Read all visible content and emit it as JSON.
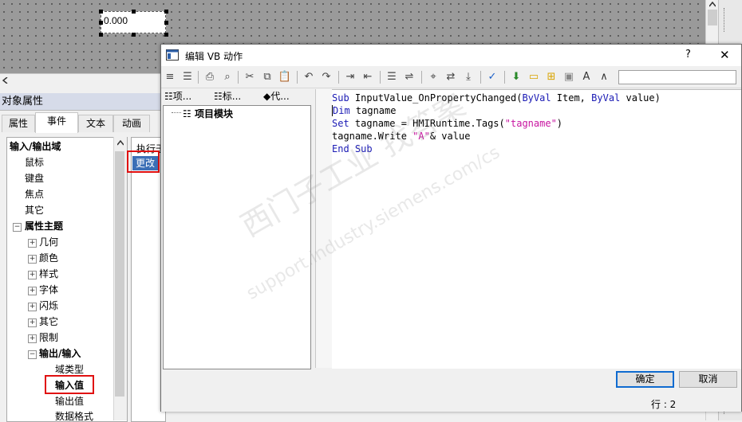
{
  "canvas": {
    "io_field_value": "0.000"
  },
  "properties": {
    "title": "对象属性",
    "tabs": [
      {
        "label": "属性"
      },
      {
        "label": "事件"
      },
      {
        "label": "文本"
      },
      {
        "label": "动画"
      }
    ],
    "tree": [
      {
        "label": "输入/输出域"
      },
      {
        "label": "鼠标"
      },
      {
        "label": "键盘"
      },
      {
        "label": "焦点"
      },
      {
        "label": "其它"
      },
      {
        "label": "属性主题"
      },
      {
        "label": "几何"
      },
      {
        "label": "颜色"
      },
      {
        "label": "样式"
      },
      {
        "label": "字体"
      },
      {
        "label": "闪烁"
      },
      {
        "label": "其它"
      },
      {
        "label": "限制"
      },
      {
        "label": "输出/输入"
      },
      {
        "label": "域类型"
      },
      {
        "label": "输入值"
      },
      {
        "label": "输出值"
      },
      {
        "label": "数据格式"
      }
    ],
    "right_header": "执行于",
    "change_label": "更改"
  },
  "dialog": {
    "title": "编辑 VB 动作",
    "help_label": "?",
    "close_label": "✕",
    "left_tabs": [
      {
        "label": "项..."
      },
      {
        "label": "标..."
      },
      {
        "label": "代..."
      }
    ],
    "left_tree_item": "项目模块",
    "code": {
      "line1": {
        "kw1": "Sub",
        "name": " InputValue_OnPropertyChanged(",
        "kw2": "ByVal",
        "p1": " Item, ",
        "kw3": "ByVal",
        "p2": " value)"
      },
      "line2": {
        "kw": "Dim",
        "rest": " tagname"
      },
      "line3": {
        "kw": "Set",
        "rest": " tagname = HMIRuntime.Tags(",
        "str": "\"tagname\"",
        "end": ")"
      },
      "line4": {
        "pre": "tagname.Write ",
        "str": "\"A\"",
        "rest": "& value"
      },
      "line5": {
        "kw1": "End",
        "kw2": " Sub"
      }
    },
    "ok_label": "确定",
    "cancel_label": "取消",
    "status": "行 : 2"
  },
  "watermark": {
    "line1": "西门子工业  找答案",
    "line2": "support.industry.siemens.com/cs"
  },
  "colors": {
    "keyword": "#1a1ab4",
    "string": "#c814a0",
    "highlight": "#e01010",
    "selection": "#3b6fb6"
  }
}
